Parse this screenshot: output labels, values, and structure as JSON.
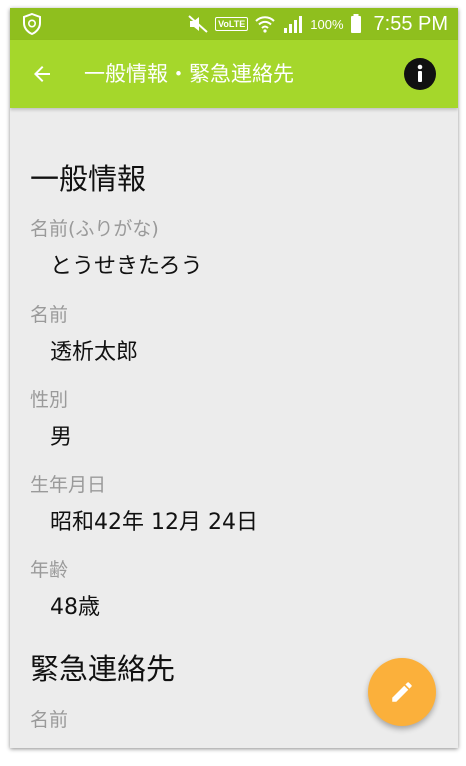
{
  "status_bar": {
    "battery_percent": "100%",
    "time": "7:55 PM",
    "volte_label": "VoLTE",
    "icons": [
      "shield-icon",
      "mute-icon",
      "wifi-icon",
      "signal-icon",
      "battery-icon"
    ]
  },
  "app_bar": {
    "title": "一般情報・緊急連絡先",
    "back_icon": "arrow-left-icon",
    "info_icon": "info-icon"
  },
  "general": {
    "title": "一般情報",
    "furigana_label": "名前(ふりがな)",
    "furigana_value": "とうせきたろう",
    "name_label": "名前",
    "name_value": "透析太郎",
    "gender_label": "性別",
    "gender_value": "男",
    "birthdate_label": "生年月日",
    "birthdate_value": "昭和42年 12月 24日",
    "age_label": "年齢",
    "age_value": "48歳"
  },
  "emergency": {
    "title": "緊急連絡先",
    "name_label": "名前"
  },
  "fab": {
    "icon": "pencil-icon"
  },
  "colors": {
    "status_bar": "#8fbf1e",
    "app_bar": "#a5d72b",
    "fab": "#fbb03b",
    "background": "#ececec",
    "label": "#9a9a9a"
  }
}
